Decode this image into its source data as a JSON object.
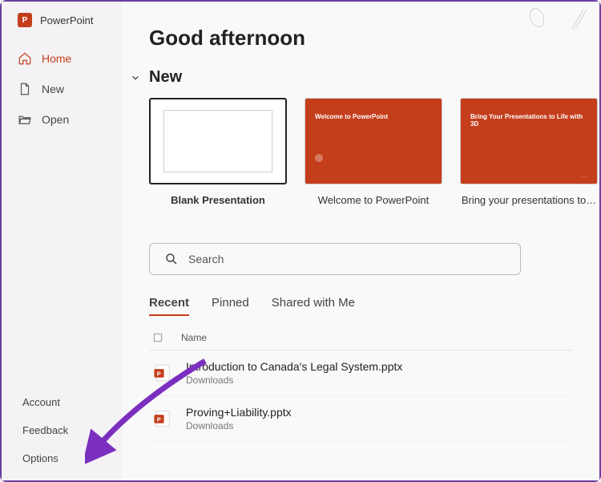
{
  "app": {
    "name": "PowerPoint"
  },
  "sidebar": {
    "top": [
      {
        "label": "Home"
      },
      {
        "label": "New"
      },
      {
        "label": "Open"
      }
    ],
    "bottom": [
      {
        "label": "Account"
      },
      {
        "label": "Feedback"
      },
      {
        "label": "Options"
      }
    ]
  },
  "main": {
    "greeting": "Good afternoon",
    "newSection": "New",
    "templates": [
      {
        "label": "Blank Presentation",
        "thumbTitle": ""
      },
      {
        "label": "Welcome to PowerPoint",
        "thumbTitle": "Welcome to PowerPoint"
      },
      {
        "label": "Bring your presentations to…",
        "thumbTitle": "Bring Your Presentations to Life with 3D"
      }
    ],
    "search": {
      "placeholder": "Search"
    },
    "tabs": [
      {
        "label": "Recent"
      },
      {
        "label": "Pinned"
      },
      {
        "label": "Shared with Me"
      }
    ],
    "listHeader": {
      "name": "Name"
    },
    "files": [
      {
        "name": "Introduction to Canada's Legal System.pptx",
        "location": "Downloads"
      },
      {
        "name": "Proving+Liability.pptx",
        "location": "Downloads"
      }
    ]
  },
  "colors": {
    "accent": "#c43e1c"
  }
}
